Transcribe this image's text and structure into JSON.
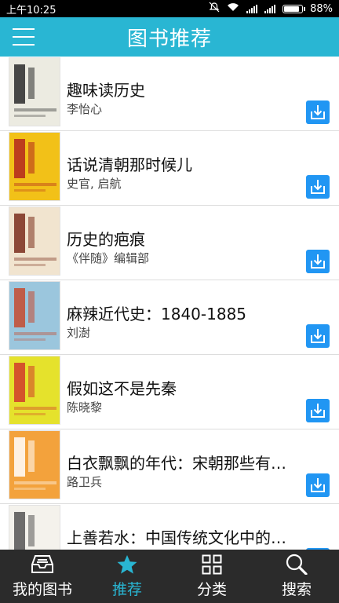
{
  "status_bar": {
    "time": "上午10:25",
    "battery": "88%"
  },
  "header": {
    "title": "图书推荐"
  },
  "books": [
    {
      "title": "趣味读历史",
      "author": "李怡心",
      "cover_bg": "#ecebe1",
      "cover_accent": "#2a2a2a",
      "cover_text": "趣味读历史"
    },
    {
      "title": "话说清朝那时候儿",
      "author": "史官, 启航",
      "cover_bg": "#f2c118",
      "cover_accent": "#b3261e",
      "cover_text": "清朝那时候儿"
    },
    {
      "title": "历史的疤痕",
      "author": "《伴随》编辑部",
      "cover_bg": "#f1e4cf",
      "cover_accent": "#7a2d1c",
      "cover_text": "历史的疤痕"
    },
    {
      "title": "麻辣近代史：1840-1885",
      "author": "刘澍",
      "cover_bg": "#9bc6dd",
      "cover_accent": "#c64a2f",
      "cover_text": ""
    },
    {
      "title": "假如这不是先秦",
      "author": "陈晓黎",
      "cover_bg": "#e5e22c",
      "cover_accent": "#d13b2c",
      "cover_text": "假如这不是先秦"
    },
    {
      "title": "白衣飘飘的年代：宋朝那些有趣的人和事",
      "author": "路卫兵",
      "cover_bg": "#f3a23c",
      "cover_accent": "#ffffff",
      "cover_text": "白衣飘飘的年代"
    },
    {
      "title": "上善若水：中国传统文化中的智慧",
      "author": "",
      "cover_bg": "#f4f2ec",
      "cover_accent": "#555555",
      "cover_text": "上善若水"
    }
  ],
  "bottom_nav": [
    {
      "label": "我的图书",
      "icon": "tray-icon",
      "active": false
    },
    {
      "label": "推荐",
      "icon": "star-icon",
      "active": true
    },
    {
      "label": "分类",
      "icon": "grid-icon",
      "active": false
    },
    {
      "label": "搜索",
      "icon": "search-icon",
      "active": false
    }
  ],
  "colors": {
    "primary": "#29b6d3",
    "download": "#2196f3",
    "nav_bg": "#2b2b2b"
  }
}
